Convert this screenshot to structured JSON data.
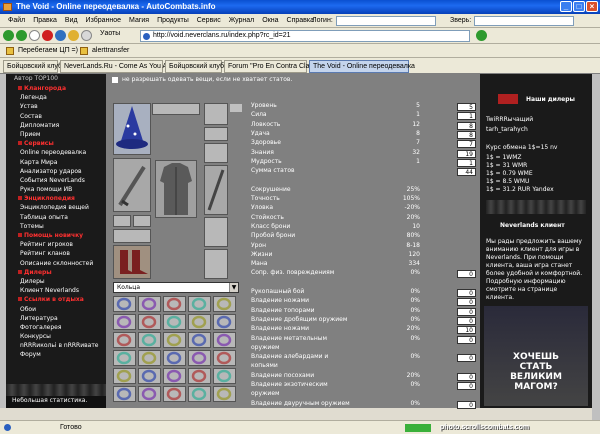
{
  "window": {
    "title": "The Void - Online переодевалка - AutoCombats.info"
  },
  "menu": {
    "items": [
      "Файл",
      "Правка",
      "Вид",
      "Избранное",
      "Магия",
      "Продукты",
      "Сервис",
      "Журнал",
      "Окна",
      "Справка"
    ],
    "login_label": "Логин:",
    "zver_label": "Зверь:"
  },
  "toolbar": {
    "utyoty": "Уаоты",
    "address": "http://void.neverclans.ru/index.php?rc_id=21"
  },
  "links": {
    "a": "Перебегаем ЦП =)",
    "b": "alerttransfer"
  },
  "tabs": [
    {
      "label": "Бойцовский клуб"
    },
    {
      "label": "NeverLands.Ru - Come As You Are"
    },
    {
      "label": "Бойцовский клуб"
    },
    {
      "label": "Forum \"Pro En Contra Clan\""
    },
    {
      "label": "The Void - Online переодевалка"
    }
  ],
  "left": {
    "top": "Автор TOP100",
    "items": [
      {
        "t": "Клангорода",
        "s": true
      },
      {
        "t": "Легенда"
      },
      {
        "t": "Устав"
      },
      {
        "t": "Состав"
      },
      {
        "t": "Дипломатия"
      },
      {
        "t": "Прием"
      },
      {
        "t": "Сервисы",
        "s": true
      },
      {
        "t": "Online переодевалка"
      },
      {
        "t": "Карта Мира"
      },
      {
        "t": "Анализатор ударов"
      },
      {
        "t": "События NeverLands"
      },
      {
        "t": "Рука помощи ИВ"
      },
      {
        "t": "Энциклопедия",
        "s": true
      },
      {
        "t": "Энциклопедия вещей"
      },
      {
        "t": "Таблица опыта"
      },
      {
        "t": "Тотемы"
      },
      {
        "t": "Помощь новичку",
        "s": true
      },
      {
        "t": "Рейтинг игроков"
      },
      {
        "t": "Рейтинг кланов"
      },
      {
        "t": "Описание склонностей"
      },
      {
        "t": "Дилеры",
        "s": true
      },
      {
        "t": "Дилеры"
      },
      {
        "t": "Клиент Neverlands"
      },
      {
        "t": "Ссылки в отдыха",
        "s": true
      },
      {
        "t": "Обои"
      },
      {
        "t": "Литература"
      },
      {
        "t": "Фотогалерея"
      },
      {
        "t": "Конкурсы"
      },
      {
        "t": "nRRRикольi в nRRRивате"
      },
      {
        "t": "Форум"
      }
    ],
    "footer": "Небольшая статистика."
  },
  "checkbox_text": "не разрешать одевать вещи, если не хватает статов.",
  "kolca": "Кольца",
  "stats": [
    {
      "n": "Уровень",
      "v": "5",
      "b": "5"
    },
    {
      "n": "Сила",
      "v": "1",
      "b": "1"
    },
    {
      "n": "Ловкость",
      "v": "12",
      "b": "8"
    },
    {
      "n": "Удача",
      "v": "8",
      "b": "8"
    },
    {
      "n": "Здоровье",
      "v": "7",
      "b": "7"
    },
    {
      "n": "Знания",
      "v": "32",
      "b": "19"
    },
    {
      "n": "Мудрость",
      "v": "1",
      "b": "1"
    },
    {
      "n": "Сумма статов",
      "v": "",
      "b": "44"
    },
    {
      "n": "",
      "v": "",
      "b": ""
    },
    {
      "n": "Сокрушение",
      "v": "25%"
    },
    {
      "n": "Точность",
      "v": "105%"
    },
    {
      "n": "Уловка",
      "v": "-20%"
    },
    {
      "n": "Стойкость",
      "v": "20%"
    },
    {
      "n": "Класс брони",
      "v": "10"
    },
    {
      "n": "Пробой брони",
      "v": "80%"
    },
    {
      "n": "Урон",
      "v": "8-18"
    },
    {
      "n": "Жизни",
      "v": "120"
    },
    {
      "n": "Мана",
      "v": "334"
    },
    {
      "n": "Сопр. физ. повреждениям",
      "v": "0%",
      "b": "0"
    },
    {
      "n": "",
      "v": "",
      "b": ""
    },
    {
      "n": "Рукопашный бой",
      "v": "0%",
      "b": "0"
    },
    {
      "n": "Владение ножами",
      "v": "0%",
      "b": "0"
    },
    {
      "n": "Владение топорами",
      "v": "0%",
      "b": "0"
    },
    {
      "n": "Владение дробящим оружием",
      "v": "0%",
      "b": "0"
    },
    {
      "n": "Владение ножами",
      "v": "20%",
      "b": "10"
    },
    {
      "n": "Владение метательным",
      "v": "0%",
      "b": "0"
    },
    {
      "n": "оружием",
      "v": "",
      "b": ""
    },
    {
      "n": "Владение алебардами и",
      "v": "0%",
      "b": "0"
    },
    {
      "n": "копьями",
      "v": "",
      "b": ""
    },
    {
      "n": "Владение посохами",
      "v": "20%",
      "b": "0"
    },
    {
      "n": "Владение экзотическим",
      "v": "0%",
      "b": "0"
    },
    {
      "n": "оружием",
      "v": "",
      "b": ""
    },
    {
      "n": "Владение двуручным оружием",
      "v": "0%",
      "b": "0"
    }
  ],
  "right": {
    "dealers_title": "Наши дилеры",
    "dealers": [
      "TwiRRRычащий",
      "tarh_tarahych"
    ],
    "rate_title": "Курс обмена 1$=15 nv",
    "rates": [
      "1$ = 1WMZ",
      "1$ = 31 WMR",
      "1$ = 0.79 WME",
      "1$ = 8.5 WMU",
      "1$ = 31.2 RUR Yandex"
    ],
    "client_title": "Neverlands клиент",
    "client_text": "Мы рады предложить вашему вниманию клиент для игры в Neverlands. При помощи клиента, ваша игра станет более удобной и комфортной. Подробную информацию смотрите на странице клиента.",
    "banner": "ХОЧЕШЬ СТАТЬ ВЕЛИКИМ МАГОМ?"
  },
  "status": {
    "text": "Готово",
    "watermark": "photo.scrollscombats.com"
  }
}
